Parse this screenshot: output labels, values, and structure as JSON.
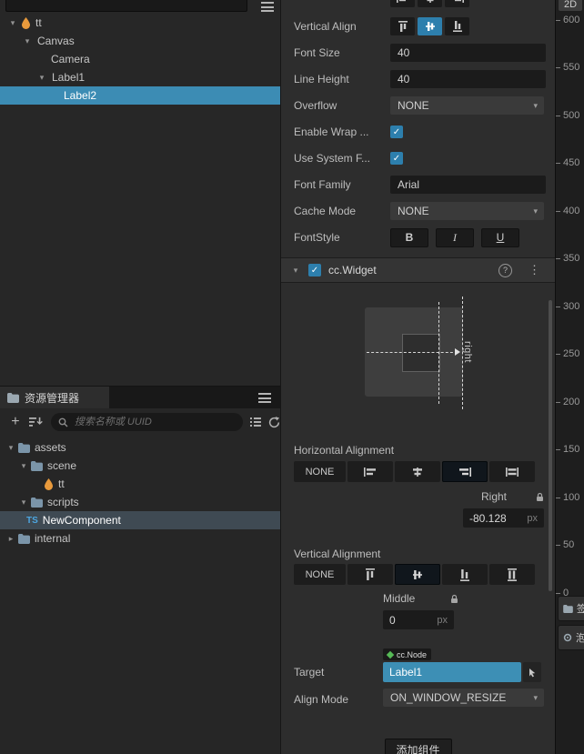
{
  "icons": {
    "chevron_down": "▾",
    "chevron_right": "▸",
    "kebab": "⋮",
    "help": "?",
    "check": "✓",
    "plus": "+"
  },
  "hierarchy": {
    "nodes": {
      "root": "tt",
      "canvas": "Canvas",
      "camera": "Camera",
      "label1": "Label1",
      "label2": "Label2"
    }
  },
  "assets": {
    "title": "资源管理器",
    "search_placeholder": "搜索名称或 UUID",
    "nodes": {
      "assets": "assets",
      "scene": "scene",
      "tt": "tt",
      "scripts": "scripts",
      "new_component": "NewComponent",
      "ts_badge": "TS",
      "internal": "internal"
    }
  },
  "inspector": {
    "rows": {
      "vertical_align": "Vertical Align",
      "font_size": "Font Size",
      "font_size_value": "40",
      "line_height": "Line Height",
      "line_height_value": "40",
      "overflow": "Overflow",
      "overflow_value": "NONE",
      "enable_wrap": "Enable Wrap ...",
      "use_system_font": "Use System F...",
      "font_family": "Font Family",
      "font_family_value": "Arial",
      "cache_mode": "Cache Mode",
      "cache_mode_value": "NONE",
      "font_style": "FontStyle",
      "bold": "B",
      "italic": "I",
      "underline": "U"
    },
    "widget": {
      "title": "cc.Widget",
      "diagram_edge_label": "right",
      "horizontal_heading": "Horizontal Alignment",
      "h_none": "NONE",
      "right_label": "Right",
      "right_value": "-80.128",
      "unit": "px",
      "vertical_heading": "Vertical Alignment",
      "v_none": "NONE",
      "middle_label": "Middle",
      "middle_value": "0",
      "target_label": "Target",
      "target_type": "cc.Node",
      "target_value": "Label1",
      "align_mode_label": "Align Mode",
      "align_mode_value": "ON_WINDOW_RESIZE"
    },
    "add_component": "添加组件"
  },
  "scene": {
    "view_toggle": "2D",
    "ruler_ticks": [
      "600",
      "550",
      "500",
      "450",
      "400",
      "350",
      "300",
      "250",
      "200",
      "150",
      "100",
      "50",
      "0"
    ],
    "bottom_tabs": [
      {
        "label": "签"
      },
      {
        "label": "泡"
      }
    ]
  }
}
